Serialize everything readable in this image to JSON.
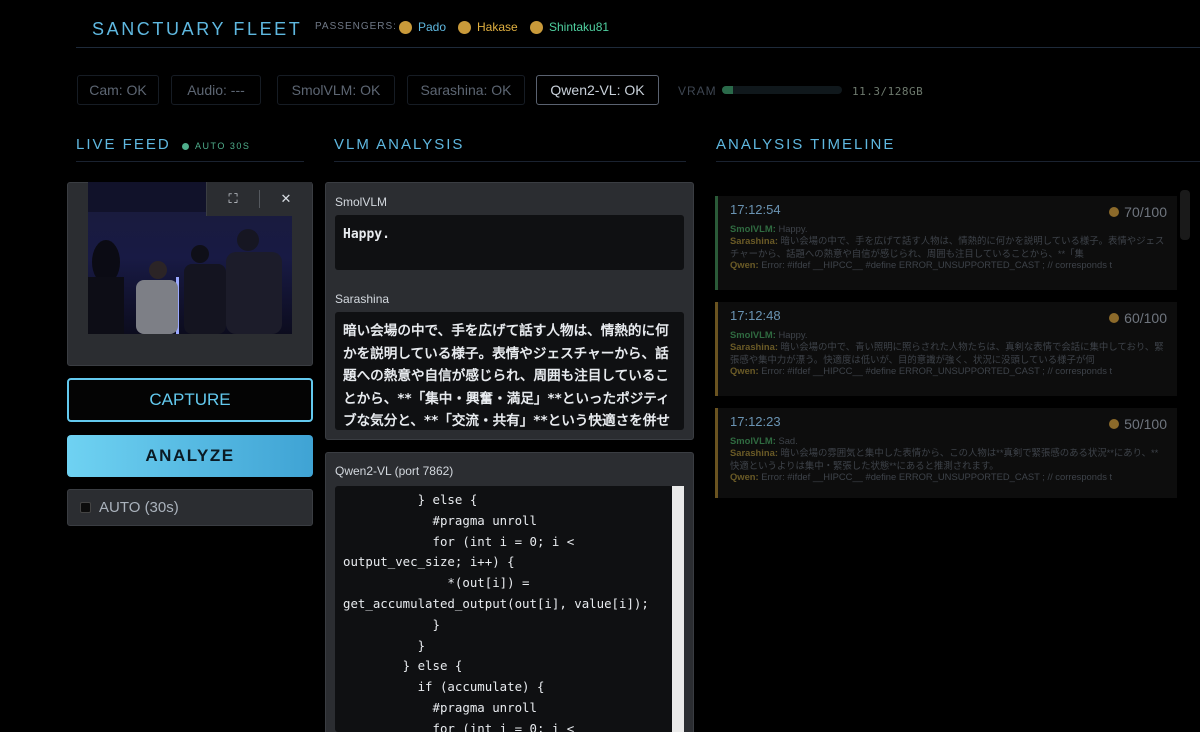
{
  "header": {
    "title": "SANCTUARY FLEET",
    "passengers_label": "PASSENGERS:",
    "passengers": [
      {
        "name": "Pado",
        "color": "#5fb8e0",
        "avatar_color": "#c99a3a"
      },
      {
        "name": "Hakase",
        "color": "#e0b040",
        "avatar_color": "#c99a3a"
      },
      {
        "name": "Shintaku81",
        "color": "#4fd0a0",
        "avatar_color": "#c99a3a"
      }
    ]
  },
  "status": {
    "items": [
      "Cam: OK",
      "Audio: ---",
      "SmolVLM: OK",
      "Sarashina: OK",
      "Qwen2-VL: OK"
    ],
    "active_index": 4,
    "vram_label": "VRAM",
    "vram_value": "11.3/128GB",
    "vram_fraction": 0.088
  },
  "live_feed": {
    "title": "LIVE FEED",
    "auto_badge": "AUTO 30S",
    "capture_label": "CAPTURE",
    "analyze_label": "ANALYZE",
    "auto_toggle_label": "AUTO (30s)",
    "auto_checked": false,
    "fullscreen_icon": "⛶",
    "close_icon": "✕"
  },
  "vlm": {
    "title": "VLM ANALYSIS",
    "smolvlm_label": "SmolVLM",
    "smolvlm_output": "Happy.",
    "sarashina_label": "Sarashina",
    "sarashina_output": "暗い会場の中で、手を広げて話す人物は、情熱的に何かを説明している様子。表情やジェスチャーから、話題への熱意や自信が感じられ、周囲も注目していることから、**「集中・興奮・満足」**といったポジティブな気分と、**「交流・共有」**という快適さを併せ持っている",
    "qwen_label": "Qwen2-VL (port 7862)",
    "qwen_output": "          } else {\n            #pragma unroll\n            for (int i = 0; i <\noutput_vec_size; i++) {\n              *(out[i]) =\nget_accumulated_output(out[i], value[i]);\n            }\n          }\n        } else {\n          if (accumulate) {\n            #pragma unroll\n            for (int i = 0; i <"
  },
  "timeline": {
    "title": "ANALYSIS TIMELINE",
    "entries": [
      {
        "time": "17:12:54",
        "score": "70/100",
        "smolvlm": "Happy.",
        "sarashina": "暗い会場の中で、手を広げて話す人物は、情熱的に何かを説明している様子。表情やジェスチャーから、話題への熱意や自信が感じられ、周囲も注目していることから、**「集",
        "qwen": "Error: #ifdef __HIPCC__ #define ERROR_UNSUPPORTED_CAST ; // corresponds t",
        "accent": "green"
      },
      {
        "time": "17:12:48",
        "score": "60/100",
        "smolvlm": "Happy.",
        "sarashina": "暗い会場の中で、青い照明に照らされた人物たちは、真剣な表情で会話に集中しており、緊張感や集中力が漂う。快適度は低いが、目的意識が強く、状況に没頭している様子が伺",
        "qwen": "Error: #ifdef __HIPCC__ #define ERROR_UNSUPPORTED_CAST ; // corresponds t",
        "accent": "amber"
      },
      {
        "time": "17:12:23",
        "score": "50/100",
        "smolvlm": "Sad.",
        "sarashina": "暗い会場の雰囲気と集中した表情から、この人物は**真剣で緊張感のある状況**にあり、**快適というよりは集中・緊張した状態**にあると推測されます。",
        "qwen": "Error: #ifdef __HIPCC__ #define ERROR_UNSUPPORTED_CAST ; // corresponds t",
        "accent": "amber"
      }
    ],
    "labels": {
      "smolvlm": "SmolVLM:",
      "sarashina": "Sarashina:",
      "qwen": "Qwen:"
    }
  }
}
